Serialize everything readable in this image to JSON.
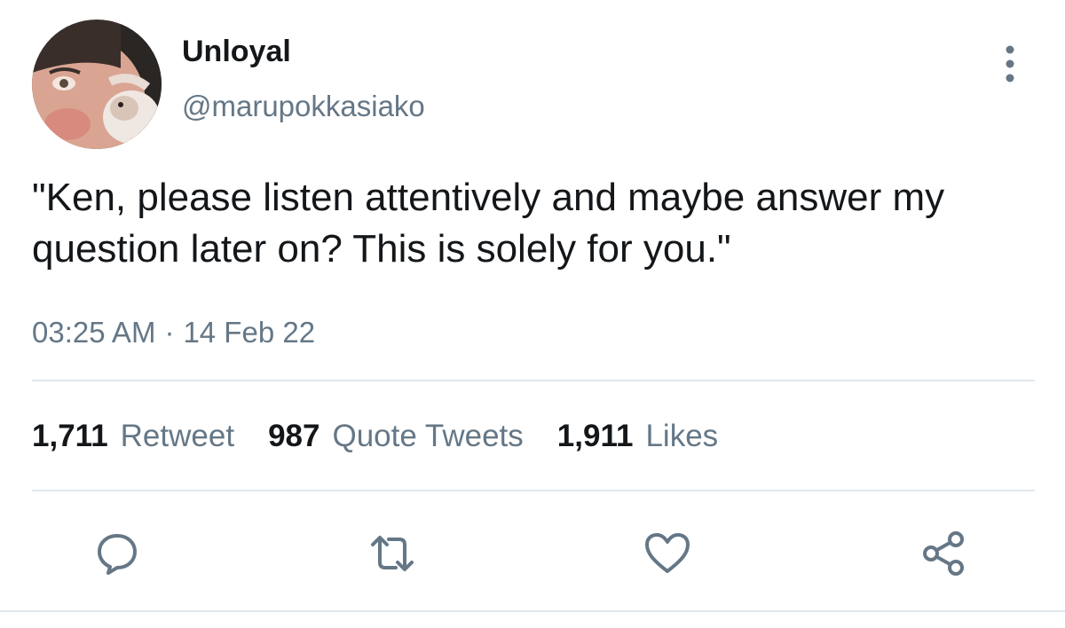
{
  "user": {
    "display_name": "Unloyal",
    "handle": "@marupokkasiako"
  },
  "tweet": {
    "text": "\"Ken, please listen attentively and maybe answer my question later on? This is solely for you.\"",
    "time": "03:25 AM",
    "separator": "·",
    "date": "14 Feb 22"
  },
  "stats": {
    "retweets_count": "1,711",
    "retweets_label": "Retweet",
    "quotes_count": "987",
    "quotes_label": "Quote Tweets",
    "likes_count": "1,911",
    "likes_label": "Likes"
  },
  "icons": {
    "more": "more-vertical-icon",
    "reply": "reply-icon",
    "retweet": "retweet-icon",
    "like": "heart-icon",
    "share": "share-icon"
  },
  "colors": {
    "text_primary": "#14171a",
    "text_secondary": "#657786",
    "divider": "#e1e8ed",
    "icon": "#657786"
  }
}
